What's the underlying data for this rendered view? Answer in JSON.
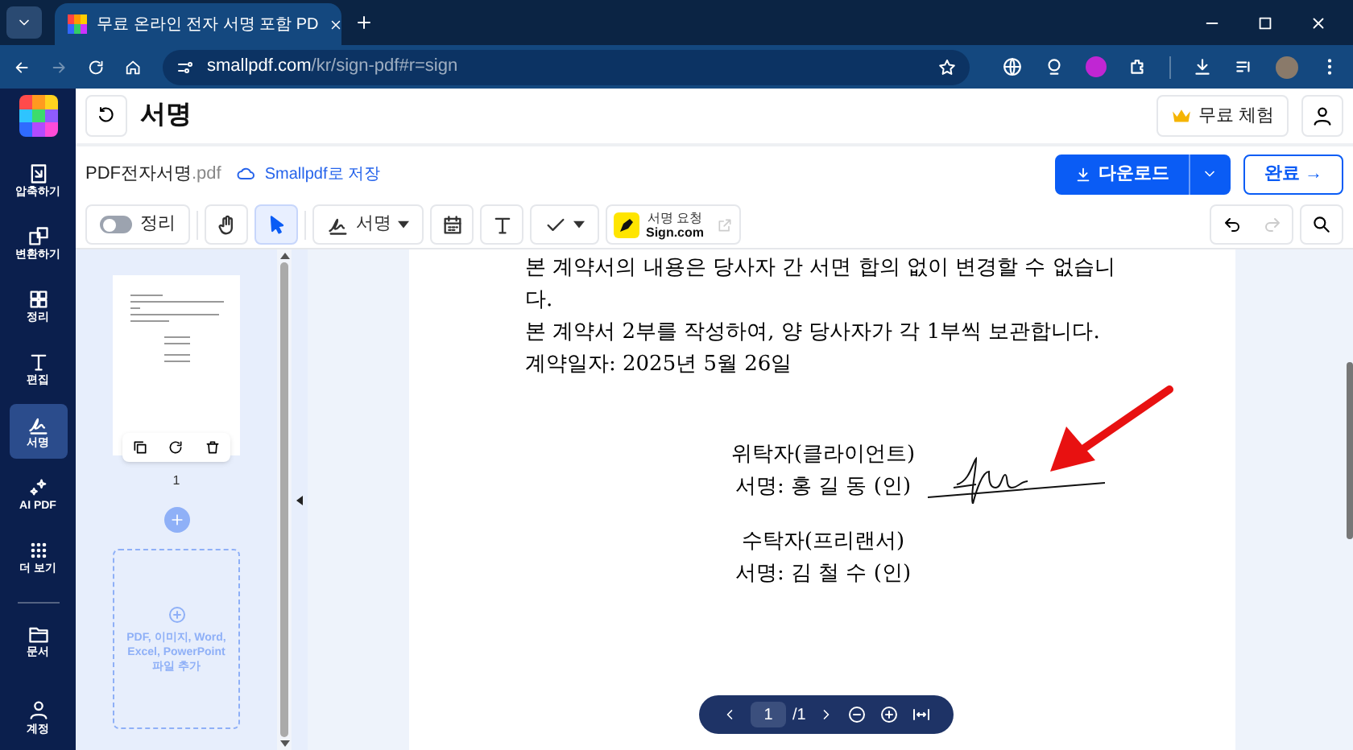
{
  "browser": {
    "tab_title": "무료 온라인 전자 서명 포함 PD",
    "url_host": "smallpdf.com",
    "url_path": "/kr/sign-pdf#r=sign"
  },
  "sidebar": {
    "items": [
      {
        "kind": "compress",
        "label": "압축하기",
        "selected": false
      },
      {
        "kind": "convert",
        "label": "변환하기",
        "selected": false
      },
      {
        "kind": "organize",
        "label": "정리",
        "selected": false
      },
      {
        "kind": "edit",
        "label": "편집",
        "selected": false
      },
      {
        "kind": "sign",
        "label": "서명",
        "selected": true
      },
      {
        "kind": "ai",
        "label": "AI PDF",
        "selected": false
      },
      {
        "kind": "more",
        "label": "더 보기",
        "selected": false
      },
      {
        "kind": "docs",
        "label": "문서",
        "selected": false
      }
    ],
    "account": "계정"
  },
  "header": {
    "title": "서명",
    "trial_button": "무료 체험"
  },
  "file": {
    "name": "PDF전자서명",
    "ext": ".pdf",
    "save_link": "Smallpdf로 저장",
    "download_button": "다운로드",
    "done_button": "완료 →"
  },
  "toolbar": {
    "organize_toggle": {
      "label": "정리",
      "on": false
    },
    "tools": [
      {
        "kind": "hand",
        "selected": false
      },
      {
        "kind": "pointer",
        "selected": true
      },
      {
        "kind": "sign",
        "label": "서명",
        "selected": false
      },
      {
        "kind": "date",
        "selected": false
      },
      {
        "kind": "text",
        "selected": false
      },
      {
        "kind": "check",
        "selected": false
      }
    ],
    "sign_request": {
      "line1": "서명 요청",
      "line2": "Sign.com"
    }
  },
  "thumbnails": {
    "pages": [
      {
        "number": "1"
      }
    ],
    "add_files": "PDF, 이미지, Word, Excel, PowerPoint 파일 추가"
  },
  "document": {
    "paragraphs": [
      "본 계약서의 내용은 당사자 간 서면 합의 없이 변경할 수 없습니 다.",
      "본 계약서 2부를 작성하여, 양 당사자가 각 1부씩 보관합니다.",
      "계약일자: 2025년 5월 26일"
    ],
    "parties": [
      {
        "role": "위탁자(클라이언트)",
        "signature": "서명: 홍 길 동  (인)",
        "signed": true
      },
      {
        "role": "수탁자(프리랜서)",
        "signature": "서명: 김 철 수 (인)",
        "signed": false
      }
    ]
  },
  "pager": {
    "page": "1",
    "total": "/1"
  }
}
